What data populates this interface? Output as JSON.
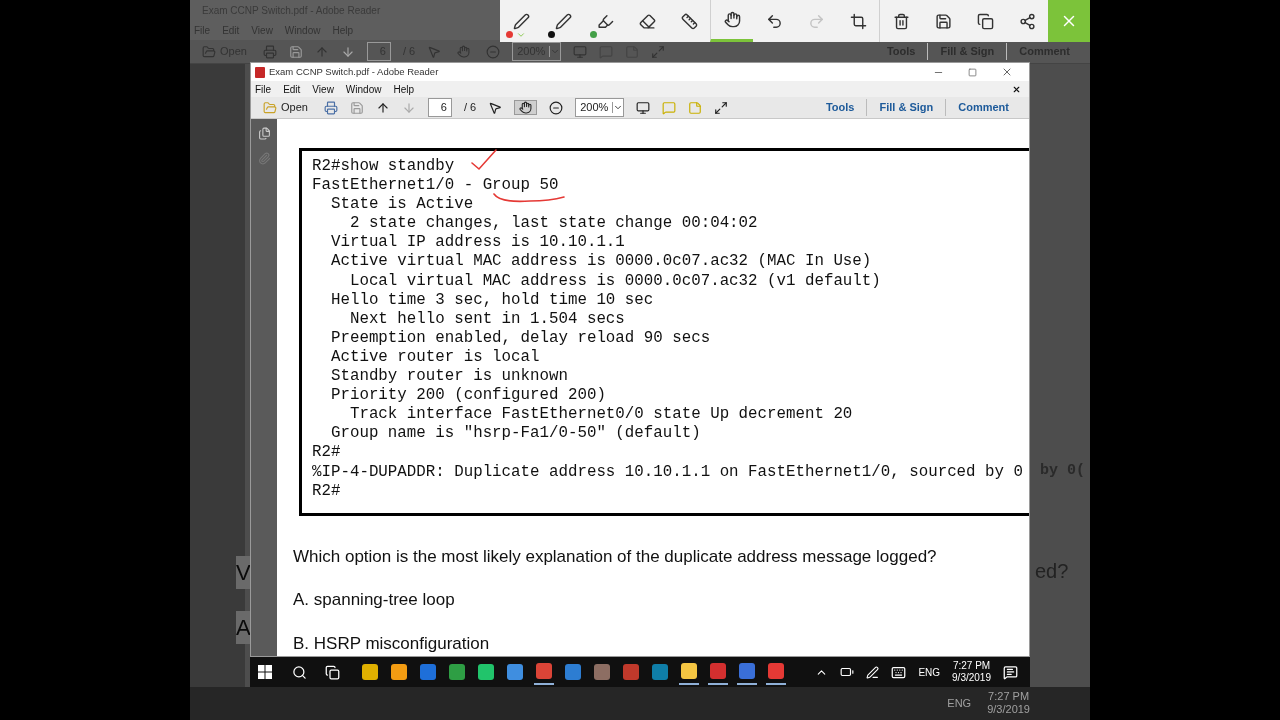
{
  "background_window": {
    "title": "Exam CCNP Switch.pdf - Adobe Reader",
    "menu": [
      "File",
      "Edit",
      "View",
      "Window",
      "Help"
    ],
    "toolbar": {
      "open": "Open",
      "page": "6",
      "page_total": "/ 6",
      "zoom": "200%",
      "panels": [
        "Tools",
        "Fill & Sign",
        "Comment"
      ]
    },
    "left_peek": [
      "V",
      "A"
    ],
    "right_peek": [
      "by 0(",
      "ed?"
    ],
    "taskbar": {
      "language": "ENG",
      "time": "7:27 PM",
      "date": "9/3/2019"
    }
  },
  "annotation_toolbar": {
    "tools": [
      {
        "kind": "pen",
        "color": "#e53935",
        "selected": true
      },
      {
        "kind": "pen",
        "color": "#111111",
        "selected": false
      },
      {
        "kind": "highlighter",
        "color": "#43a047",
        "selected": false
      },
      {
        "kind": "eraser"
      },
      {
        "kind": "ruler"
      },
      {
        "kind": "touch",
        "selected": true
      },
      {
        "kind": "undo",
        "disabled": false
      },
      {
        "kind": "redo",
        "disabled": true
      },
      {
        "kind": "crop",
        "disabled": false
      },
      {
        "kind": "delete"
      },
      {
        "kind": "save"
      },
      {
        "kind": "copy"
      },
      {
        "kind": "share"
      }
    ]
  },
  "window": {
    "title": "Exam CCNP Switch.pdf - Adobe Reader",
    "menu": [
      "File",
      "Edit",
      "View",
      "Window",
      "Help"
    ],
    "toolbar": {
      "open": "Open",
      "page": "6",
      "page_total": "/ 6",
      "zoom": "200%",
      "hand_selected": true,
      "panels": [
        "Tools",
        "Fill & Sign",
        "Comment"
      ]
    },
    "terminal_lines": [
      "R2#show standby",
      "FastEthernet1/0 - Group 50",
      "  State is Active",
      "    2 state changes, last state change 00:04:02",
      "  Virtual IP address is 10.10.1.1",
      "  Active virtual MAC address is 0000.0c07.ac32 (MAC In Use)",
      "    Local virtual MAC address is 0000.0c07.ac32 (v1 default)",
      "  Hello time 3 sec, hold time 10 sec",
      "    Next hello sent in 1.504 secs",
      "  Preemption enabled, delay reload 90 secs",
      "  Active router is local",
      "  Standby router is unknown",
      "  Priority 200 (configured 200)",
      "    Track interface FastEthernet0/0 state Up decrement 20",
      "  Group name is \"hsrp-Fa1/0-50\" (default)",
      "R2#",
      "%IP-4-DUPADDR: Duplicate address 10.10.1.1 on FastEthernet1/0, sourced by 0",
      "R2#"
    ],
    "question": "Which option is the most likely explanation of the duplicate address message logged?",
    "options": [
      "A. spanning-tree loop",
      "B. HSRP misconfiguration"
    ]
  },
  "taskbar": {
    "apps": [
      {
        "color": "#e0b000",
        "running": false
      },
      {
        "color": "#f39c12",
        "running": false
      },
      {
        "color": "#1e6fd9",
        "running": false
      },
      {
        "color": "#2e9e44",
        "running": false
      },
      {
        "color": "#21c46b",
        "running": false
      },
      {
        "color": "#3f8ee0",
        "running": false
      },
      {
        "color": "#db4437",
        "running": true
      },
      {
        "color": "#2d7dd2",
        "running": false
      },
      {
        "color": "#8d6e63",
        "running": false
      },
      {
        "color": "#c0392b",
        "running": false
      },
      {
        "color": "#0f7ea8",
        "running": false
      },
      {
        "color": "#f4c542",
        "running": true
      },
      {
        "color": "#d32f2f",
        "running": true
      },
      {
        "color": "#3a6fd8",
        "running": true
      },
      {
        "color": "#e53935",
        "running": true
      }
    ],
    "language": "ENG",
    "time": "7:27 PM",
    "date": "9/3/2019"
  }
}
